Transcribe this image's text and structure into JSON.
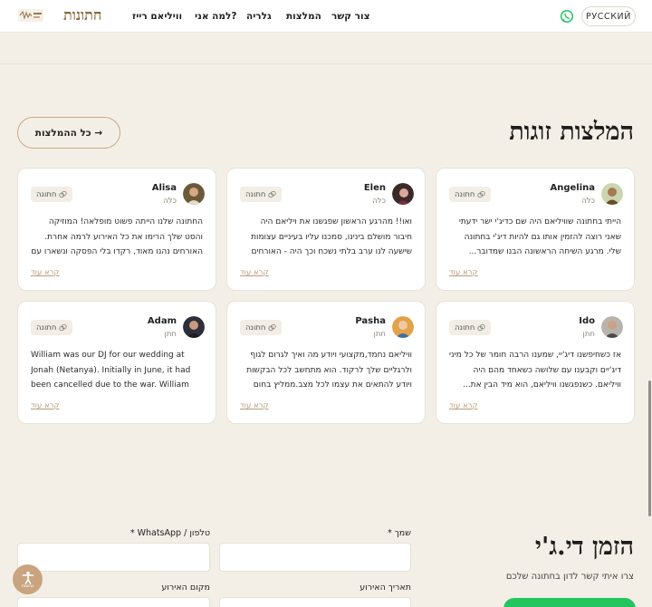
{
  "header": {
    "lang_button": "РУССКИЙ",
    "nav": {
      "contact": "צור קשר",
      "recommendations": "המלצות",
      "gallery": "גלריה",
      "why_me": "למה אני?",
      "william_rice": "וויליאם רייז"
    },
    "logo_text": "חתונות",
    "icons": [
      "whatsapp-icon",
      "logo-image"
    ]
  },
  "recommendations": {
    "title": "המלצות זוגות",
    "all_button": "כל ההמלצות →",
    "tag_label": "חתונה",
    "read_more": "קרא עוד",
    "cards": [
      {
        "name": "Angelina",
        "role": "כלה",
        "text": "הייתי בחתונה שוויליאם היה שם כדיג'י ישר ידעתי שאני רוצה להזמין אותו גם להיות דיג'י בחתונה שלי. מרגע השיחה הראשונה הבנו שמדובר..."
      },
      {
        "name": "Elen",
        "role": "כלה",
        "text": "ואו!! מהרגע הראשון שפגשנו את ויליאם היה חיבור מושלם בינינו, סמכנו עליו בעיניים עצומות שישעה לנו ערב בלתי נשכח וכך היה - האורחים לא זזו..."
      },
      {
        "name": "Alisa",
        "role": "כלה",
        "text": "החתונה שלנו הייתה פשוט מופלאה! המוזיקה והסט שלך הרימו את כל האירוע לרמה אחרת. האורחים נהנו מאוד, רקדו בלי הפסקה ונשארו עם חיוך גדול..."
      },
      {
        "name": "Ido",
        "role": "חתן",
        "text": "אז כשחיפשנו דיג'יי, שמענו הרבה חומר של כל מיני דיג'יים וקבענו עם שלושה כשאחד מהם היה וויליאם. כשנפגשנו וויליאם, הוא מיד הבין את..."
      },
      {
        "name": "Pasha",
        "role": "חתן",
        "text": "וויליאם נחמד,מקצועי ויודע מה ואיך לגרום לגוף ולרגליים שלך לרקוד. הוא מתחשב לכל הבקשות ויודע להתאים את עצמו לכל מצב.ממליץ בחום גד..."
      },
      {
        "name": "Adam",
        "role": "חתן",
        "text": "William was our DJ for our wedding at Jonah (Netanya). Initially in June, it had been cancelled due to the war. William was flexible..."
      }
    ]
  },
  "booking": {
    "title": "הזמן די.ג'י",
    "subtitle": "צרו איתי קשר לדון בחתונה שלכם",
    "labels": {
      "name": "שמך *",
      "phone": "טלפון / WhatsApp *",
      "date": "תאריך האירוע",
      "venue": "מקום האירוע"
    }
  },
  "accessibility": {
    "label": "נגישות"
  },
  "colors": {
    "accent": "#c9a884",
    "background": "#f4efe6",
    "whatsapp": "#22c55e"
  }
}
